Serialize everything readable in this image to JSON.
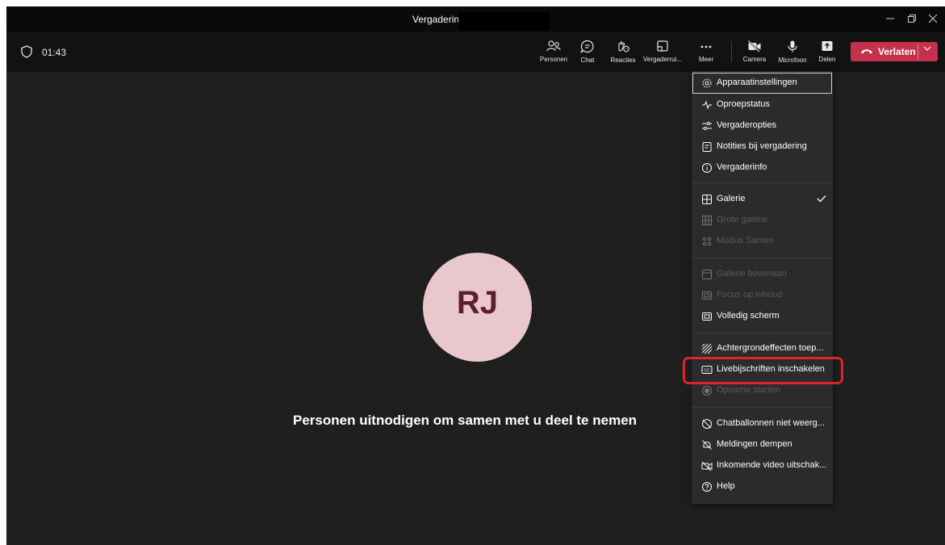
{
  "window": {
    "title": "Vergadering"
  },
  "meeting": {
    "timer": "01:43"
  },
  "toolbar": {
    "people": "Personen",
    "chat": "Chat",
    "reactions": "Reacties",
    "rooms": "Vergaderrui...",
    "more": "Meer",
    "camera": "Camera",
    "microphone": "Microfoon",
    "share": "Delen",
    "leave": "Verlaten"
  },
  "participant": {
    "initials": "RJ",
    "avatar_color": "#e8c8cc",
    "initials_color": "#5d1f2a"
  },
  "invite_text": "Personen uitnodigen om samen met u deel te nemen",
  "menu": {
    "items": [
      {
        "label": "Apparaatinstellingen",
        "icon": "gear-icon"
      },
      {
        "label": "Oproepstatus",
        "icon": "pulse-icon"
      },
      {
        "label": "Vergaderopties",
        "icon": "sliders-icon"
      },
      {
        "label": "Notities bij vergadering",
        "icon": "notes-icon"
      },
      {
        "label": "Vergaderinfo",
        "icon": "info-icon"
      },
      {
        "label": "Galerie",
        "icon": "grid-icon"
      },
      {
        "label": "Grote galerie",
        "icon": "large-grid-icon"
      },
      {
        "label": "Modus Samen",
        "icon": "together-mode-icon"
      },
      {
        "label": "Galerie bovenaan",
        "icon": "gallery-top-icon"
      },
      {
        "label": "Focus op inhoud",
        "icon": "focus-icon"
      },
      {
        "label": "Volledig scherm",
        "icon": "fullscreen-icon"
      },
      {
        "label": "Achtergrondeffecten toep...",
        "icon": "background-effects-icon"
      },
      {
        "label": "Livebijschriften inschakelen",
        "icon": "closed-captions-icon"
      },
      {
        "label": "Opname starten",
        "icon": "record-icon"
      },
      {
        "label": "Chatballonnen niet weerg...",
        "icon": "chat-bubble-off-icon"
      },
      {
        "label": "Meldingen dempen",
        "icon": "bell-off-icon"
      },
      {
        "label": "Inkomende video uitschak...",
        "icon": "video-off-icon"
      },
      {
        "label": "Help",
        "icon": "help-icon"
      }
    ]
  },
  "colors": {
    "leave_button": "#c4314b",
    "highlight": "#d9252d",
    "menu_bg": "#2b2b2b",
    "stage_bg": "#1f1f1f"
  }
}
